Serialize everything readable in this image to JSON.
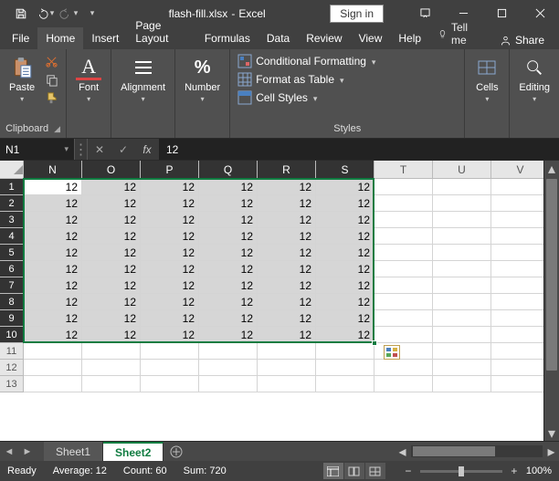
{
  "window": {
    "filename": "flash-fill.xlsx",
    "app": "Excel",
    "separator": " - ",
    "signin": "Sign in"
  },
  "tabs": {
    "file": "File",
    "home": "Home",
    "insert": "Insert",
    "pagelayout": "Page Layout",
    "formulas": "Formulas",
    "data": "Data",
    "review": "Review",
    "view": "View",
    "help": "Help",
    "tellme": "Tell me",
    "share": "Share"
  },
  "ribbon": {
    "clipboard": {
      "label": "Clipboard",
      "paste": "Paste"
    },
    "font": {
      "label": "Font",
      "btn": "Font"
    },
    "alignment": {
      "label": "",
      "btn": "Alignment"
    },
    "number": {
      "label": "",
      "btn": "Number"
    },
    "styles": {
      "label": "Styles",
      "cond": "Conditional Formatting",
      "table": "Format as Table",
      "cells": "Cell Styles"
    },
    "cellsgrp": {
      "label": "",
      "btn": "Cells"
    },
    "editing": {
      "label": "",
      "btn": "Editing"
    }
  },
  "formula": {
    "namebox": "N1",
    "fx": "fx",
    "value": "12"
  },
  "grid": {
    "cols": [
      "N",
      "O",
      "P",
      "Q",
      "R",
      "S",
      "T",
      "U",
      "V"
    ],
    "sel_cols": 6,
    "rows": [
      1,
      2,
      3,
      4,
      5,
      6,
      7,
      8,
      9,
      10,
      11,
      12,
      13
    ],
    "sel_rows": 10,
    "data": [
      [
        "12",
        "12",
        "12",
        "12",
        "12",
        "12"
      ],
      [
        "12",
        "12",
        "12",
        "12",
        "12",
        "12"
      ],
      [
        "12",
        "12",
        "12",
        "12",
        "12",
        "12"
      ],
      [
        "12",
        "12",
        "12",
        "12",
        "12",
        "12"
      ],
      [
        "12",
        "12",
        "12",
        "12",
        "12",
        "12"
      ],
      [
        "12",
        "12",
        "12",
        "12",
        "12",
        "12"
      ],
      [
        "12",
        "12",
        "12",
        "12",
        "12",
        "12"
      ],
      [
        "12",
        "12",
        "12",
        "12",
        "12",
        "12"
      ],
      [
        "12",
        "12",
        "12",
        "12",
        "12",
        "12"
      ],
      [
        "12",
        "12",
        "12",
        "12",
        "12",
        "12"
      ]
    ]
  },
  "sheets": {
    "s1": "Sheet1",
    "s2": "Sheet2"
  },
  "status": {
    "ready": "Ready",
    "avg": "Average: 12",
    "count": "Count: 60",
    "sum": "Sum: 720",
    "zoom": "100%"
  },
  "colors": {
    "green": "#107c41"
  }
}
